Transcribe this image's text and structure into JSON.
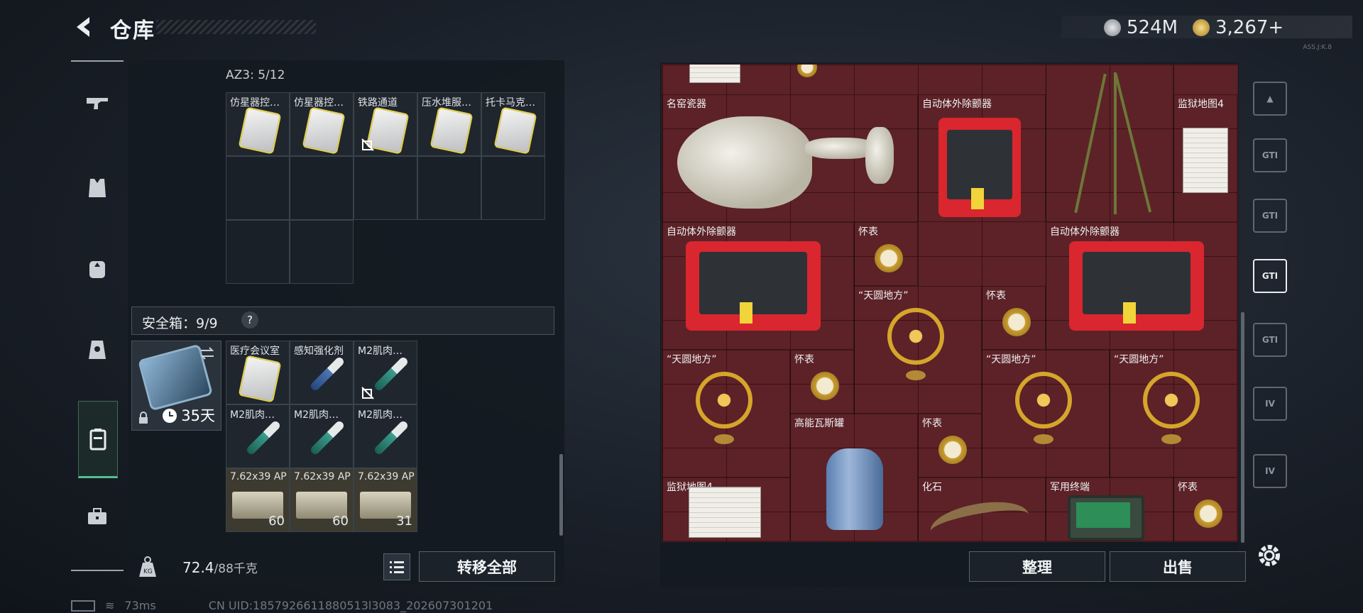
{
  "header": {
    "title": "仓库",
    "currency": [
      {
        "icon": "silver-coin-icon",
        "value": "524M"
      },
      {
        "icon": "gold-coin-icon",
        "value": "3,267+"
      }
    ],
    "sub_code": "ASS.J:K.8"
  },
  "left_nav": {
    "items": [
      {
        "icon": "gun-icon"
      },
      {
        "icon": "vest-icon"
      },
      {
        "icon": "backpack-icon"
      },
      {
        "icon": "chest-rig-icon"
      },
      {
        "icon": "safe-case-icon",
        "active": true
      },
      {
        "icon": "toolbox-icon"
      }
    ]
  },
  "container": {
    "capacity": "AZ3: 5/12",
    "items": [
      {
        "label": "仿星器控…",
        "type": "card"
      },
      {
        "label": "仿星器控…",
        "type": "card"
      },
      {
        "label": "铁路通道",
        "type": "card",
        "no_enter": true
      },
      {
        "label": "压水堆服…",
        "type": "card"
      },
      {
        "label": "托卡马克…",
        "type": "card"
      }
    ]
  },
  "safebox": {
    "label": "安全箱：9/9",
    "help": "?",
    "case_days": "35天",
    "items": [
      {
        "label": "医疗会议室",
        "type": "card"
      },
      {
        "label": "感知强化剂",
        "type": "syringe-blue"
      },
      {
        "label": "M2肌肉…",
        "type": "syringe",
        "no_enter": true
      },
      {
        "label": "M2肌肉…",
        "type": "syringe"
      },
      {
        "label": "M2肌肉…",
        "type": "syringe"
      },
      {
        "label": "M2肌肉…",
        "type": "syringe"
      },
      {
        "label": "7.62x39 AP",
        "type": "ammo",
        "qty": "60"
      },
      {
        "label": "7.62x39 AP",
        "type": "ammo",
        "qty": "60"
      },
      {
        "label": "7.62x39 AP",
        "type": "ammo",
        "qty": "31"
      }
    ]
  },
  "weight": {
    "current": "72.4",
    "max": "/88千克"
  },
  "buttons": {
    "transfer_all": "转移全部",
    "organize": "整理",
    "sell": "出售"
  },
  "right_items": {
    "vase": "名窑瓷器",
    "aed1": "自动体外除颤器",
    "aed2": "自动体外除颤器",
    "aed3": "自动体外除颤器",
    "map1": "监狱地图4",
    "map2": "监狱地图4",
    "watch1": "怀表",
    "watch2": "怀表",
    "watch3": "怀表",
    "watch4": "怀表",
    "watch5": "怀表",
    "globe1": "“天圆地方”",
    "globe2": "“天圆地方”",
    "globe3": "“天圆地方”",
    "globe4": "“天圆地方”",
    "gas": "高能瓦斯罐",
    "fossil": "化石",
    "terminal": "军用终端"
  },
  "right_nav": [
    {
      "label": "▲",
      "icon": "arch-icon"
    },
    {
      "label": "GTI",
      "icon": "gti-icon"
    },
    {
      "label": "GTI",
      "icon": "gti-icon"
    },
    {
      "label": "GTI",
      "icon": "gti-icon",
      "active": true
    },
    {
      "label": "GTI",
      "icon": "gti-icon"
    },
    {
      "label": "IV",
      "icon": "folder-icon"
    },
    {
      "label": "IV",
      "icon": "folder-icon"
    }
  ],
  "footer": {
    "ping": "73ms",
    "uid": "CN UID:1857926611880513l3083_202607301201"
  }
}
